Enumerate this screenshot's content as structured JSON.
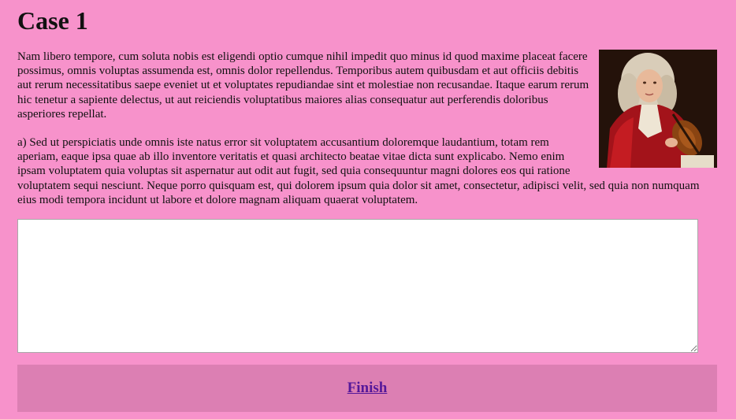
{
  "heading": "Case 1",
  "paragraphs": {
    "intro": "Nam libero tempore, cum soluta nobis est eligendi optio cumque nihil impedit quo minus id quod maxime placeat facere possimus, omnis voluptas assumenda est, omnis dolor repellendus. Temporibus autem quibusdam et aut officiis debitis aut rerum necessitatibus saepe eveniet ut et voluptates repudiandae sint et molestiae non recusandae. Itaque earum rerum hic tenetur a sapiente delectus, ut aut reiciendis voluptatibus maiores alias consequatur aut perferendis doloribus asperiores repellat.",
    "question": "a) Sed ut perspiciatis unde omnis iste natus error sit voluptatem accusantium doloremque laudantium, totam rem aperiam, eaque ipsa quae ab illo inventore veritatis et quasi architecto beatae vitae dicta sunt explicabo. Nemo enim ipsam voluptatem quia voluptas sit aspernatur aut odit aut fugit, sed quia consequuntur magni dolores eos qui ratione voluptatem sequi nesciunt. Neque porro quisquam est, qui dolorem ipsum quia dolor sit amet, consectetur, adipisci velit, sed quia non numquam eius modi tempora incidunt ut labore et dolore magnam aliquam quaerat voluptatem."
  },
  "answer": {
    "value": "",
    "placeholder": ""
  },
  "finish_label": "Finish",
  "colors": {
    "background": "#f792cb",
    "finish_bar": "#dc7fb3",
    "link": "#55189a"
  }
}
